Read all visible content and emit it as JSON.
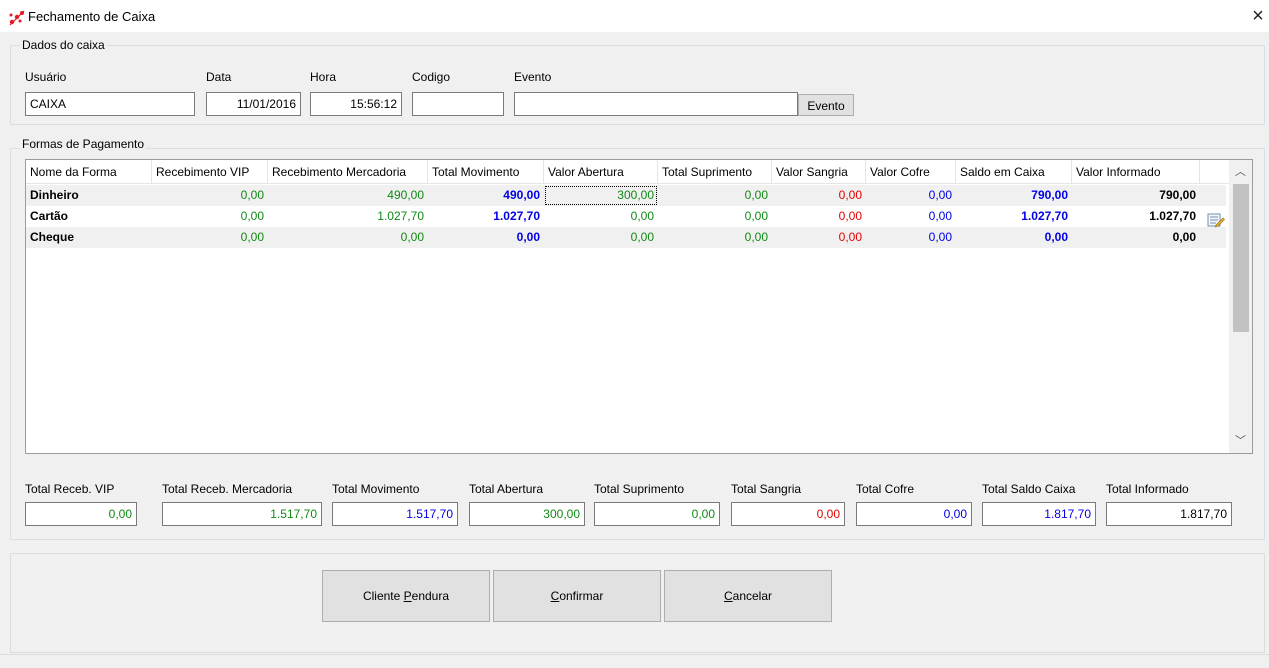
{
  "window": {
    "title": "Fechamento de Caixa",
    "close_glyph": "×",
    "icon": "app-logo-icon"
  },
  "dados": {
    "legend": "Dados do caixa",
    "usuario_label": "Usuário",
    "usuario_value": "CAIXA",
    "data_label": "Data",
    "data_value": "11/01/2016",
    "hora_label": "Hora",
    "hora_value": "15:56:12",
    "codigo_label": "Codigo",
    "codigo_value": "",
    "evento_label": "Evento",
    "evento_value": "",
    "evento_button": "Evento"
  },
  "formas": {
    "legend": "Formas de Pagamento",
    "columns": [
      "Nome da Forma",
      "Recebimento VIP",
      "Recebimento Mercadoria",
      "Total Movimento",
      "Valor Abertura",
      "Total Suprimento",
      "Valor Sangria",
      "Valor Cofre",
      "Saldo em Caixa",
      "Valor Informado"
    ],
    "rows": [
      {
        "nome": "Dinheiro",
        "vip": "0,00",
        "mercadoria": "490,00",
        "movimento": "490,00",
        "abertura": "300,00",
        "suprimento": "0,00",
        "sangria": "0,00",
        "cofre": "0,00",
        "saldo": "790,00",
        "informado": "790,00"
      },
      {
        "nome": "Cartão",
        "vip": "0,00",
        "mercadoria": "1.027,70",
        "movimento": "1.027,70",
        "abertura": "0,00",
        "suprimento": "0,00",
        "sangria": "0,00",
        "cofre": "0,00",
        "saldo": "1.027,70",
        "informado": "1.027,70"
      },
      {
        "nome": "Cheque",
        "vip": "0,00",
        "mercadoria": "0,00",
        "movimento": "0,00",
        "abertura": "0,00",
        "suprimento": "0,00",
        "sangria": "0,00",
        "cofre": "0,00",
        "saldo": "0,00",
        "informado": "0,00"
      }
    ]
  },
  "totais": {
    "vip_label": "Total Receb. VIP",
    "vip_value": "0,00",
    "mercadoria_label": "Total Receb. Mercadoria",
    "mercadoria_value": "1.517,70",
    "movimento_label": "Total Movimento",
    "movimento_value": "1.517,70",
    "abertura_label": "Total Abertura",
    "abertura_value": "300,00",
    "suprimento_label": "Total Suprimento",
    "suprimento_value": "0,00",
    "sangria_label": "Total Sangria",
    "sangria_value": "0,00",
    "cofre_label": "Total Cofre",
    "cofre_value": "0,00",
    "saldo_label": "Total Saldo Caixa",
    "saldo_value": "1.817,70",
    "informado_label": "Total Informado",
    "informado_value": "1.817,70"
  },
  "buttons": {
    "cliente_pendura": {
      "pre": "Cliente ",
      "key": "P",
      "post": "endura"
    },
    "confirmar": {
      "pre": "",
      "key": "C",
      "post": "onfirmar"
    },
    "cancelar": {
      "pre": "",
      "key": "C",
      "post": "ancelar"
    }
  },
  "colors": {
    "green": "#0f8a14",
    "blue": "#0000e6",
    "red": "#e60000"
  },
  "icons": {
    "edit": "edit-pencil-icon",
    "scroll_up": "chevron-up-icon",
    "scroll_down": "chevron-down-icon"
  }
}
